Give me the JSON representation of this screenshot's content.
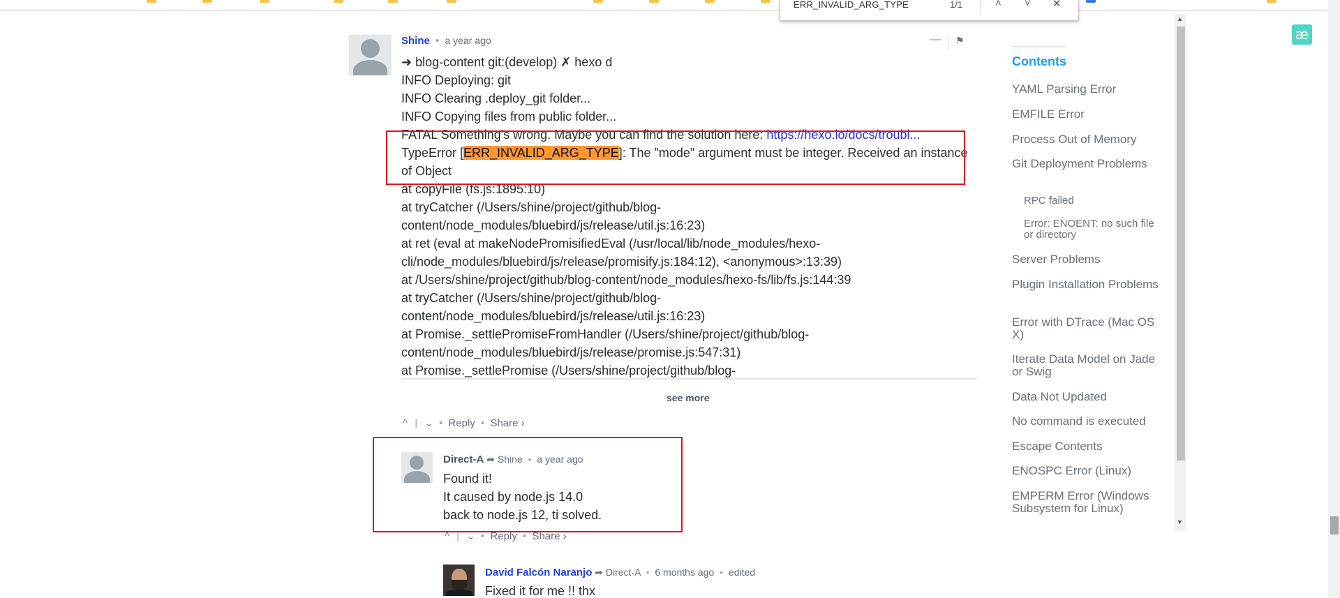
{
  "find_bar": {
    "query": "ERR_INVALID_ARG_TYPE",
    "count": "1/1"
  },
  "main_comment": {
    "author": "Shine",
    "time": "a year ago",
    "lines": [
      "➜ blog-content git:(develop) ✗ hexo d",
      "INFO Deploying: git",
      "INFO Clearing .deploy_git folder...",
      "INFO Copying files from public folder...",
      "FATAL Something's wrong. Maybe you can find the solution here: "
    ],
    "fatal_link": "https://hexo.io/docs/troubl...",
    "type_error_prefix": "TypeError [",
    "type_error_code": "ERR_INVALID_ARG_TYPE",
    "type_error_suffix": "]: The \"mode\" argument must be integer. Received an instance of Object",
    "stack": [
      "at copyFile (fs.js:1895:10)",
      "at tryCatcher (/Users/shine/project/github/blog-",
      "content/node_modules/bluebird/js/release/util.js:16:23)",
      "at ret (eval at makeNodePromisifiedEval (/usr/local/lib/node_modules/hexo-",
      "cli/node_modules/bluebird/js/release/promisify.js:184:12), <anonymous>:13:39)",
      "at /Users/shine/project/github/blog-content/node_modules/hexo-fs/lib/fs.js:144:39",
      "at tryCatcher (/Users/shine/project/github/blog-",
      "content/node_modules/bluebird/js/release/util.js:16:23)",
      "at Promise._settlePromiseFromHandler (/Users/shine/project/github/blog-",
      "content/node_modules/bluebird/js/release/promise.js:547:31)",
      "at Promise._settlePromise (/Users/shine/project/github/blog-"
    ],
    "see_more": "see more",
    "reply_label": "Reply",
    "share_label": "Share ›"
  },
  "reply": {
    "author": "Direct-A",
    "in_reply_to": "Shine",
    "time": "a year ago",
    "lines": [
      "Found it!",
      "It caused by node.js 14.0",
      "back to node.js 12, ti solved."
    ],
    "reply_label": "Reply",
    "share_label": "Share ›"
  },
  "reply2": {
    "author": "David Falcón Naranjo",
    "in_reply_to": "Direct-A",
    "time": "6 months ago",
    "edited": "edited",
    "text": "Fixed it for me !! thx"
  },
  "toc": {
    "title": "Contents",
    "items": [
      "YAML Parsing Error",
      "EMFILE Error",
      "Process Out of Memory",
      "Git Deployment Problems",
      "RPC failed",
      "Error: ENOENT: no such file or directory",
      "Server Problems",
      "Plugin Installation Problems",
      "Error with DTrace (Mac OS X)",
      "Iterate Data Model on Jade or Swig",
      "Data Not Updated",
      "No command is executed",
      "Escape Contents",
      "ENOSPC Error (Linux)",
      "EMPERM Error (Windows Subsystem for Linux)"
    ]
  },
  "colors": {
    "accent": "#1aa1e6",
    "highlight": "#ff9632",
    "annotation": "#e3121b",
    "author_link": "#1e3fd6"
  }
}
